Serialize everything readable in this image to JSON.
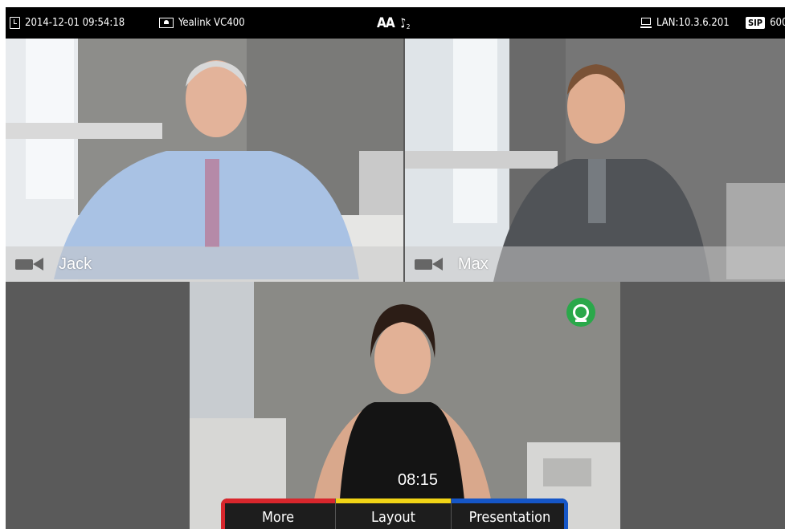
{
  "status_bar": {
    "datetime": "2014-12-01 09:54:18",
    "device_name": "Yealink VC400",
    "aa_indicator": "AA",
    "handset_count": "2",
    "lan_address": "LAN:10.3.6.201",
    "sip_badge": "SIP",
    "sip_account": "600"
  },
  "participants": [
    {
      "name": "Jack"
    },
    {
      "name": "Max"
    }
  ],
  "call": {
    "duration": "08:15"
  },
  "softkeys": [
    {
      "label": "More",
      "color": "#d8262c"
    },
    {
      "label": "Layout",
      "color": "#f1d416"
    },
    {
      "label": "Presentation",
      "color": "#1556c7"
    }
  ],
  "colors": {
    "status_bar_bg": "#000000",
    "screen_bg": "#5a5a5a",
    "webcam_indicator": "#2aa84a"
  },
  "icons": [
    "clock-icon",
    "device-icon",
    "handset-icon",
    "network-icon",
    "camera-muted-icon",
    "webcam-icon"
  ]
}
